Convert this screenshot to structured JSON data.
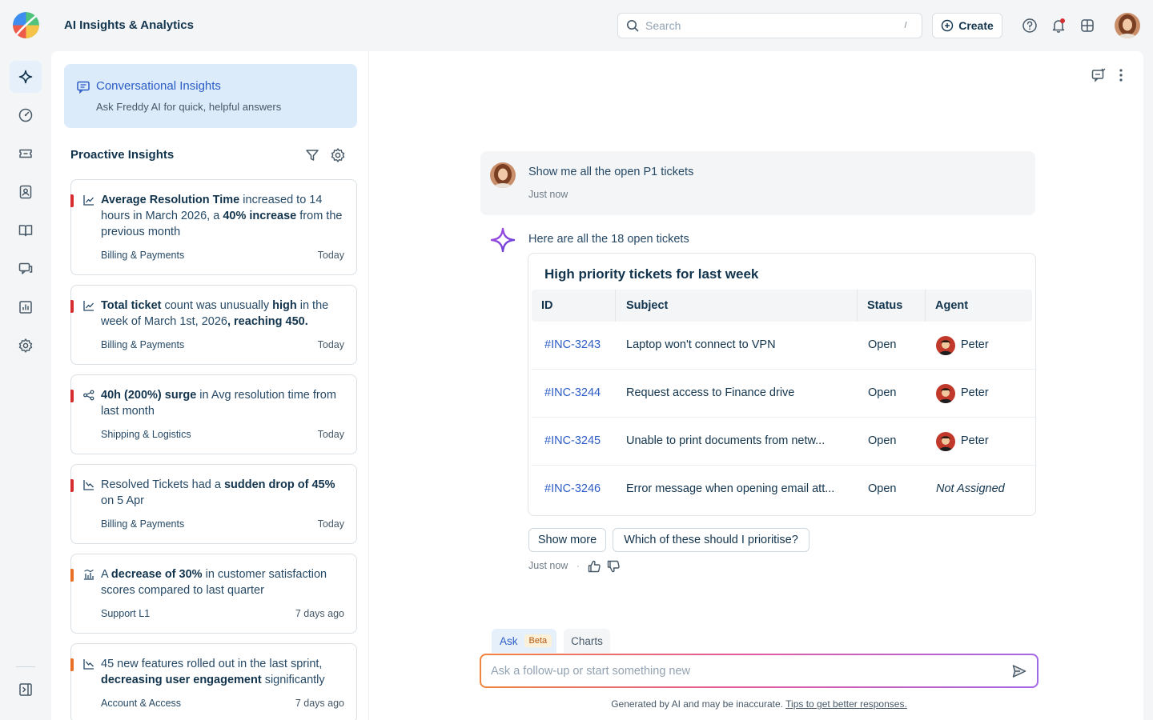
{
  "app": {
    "title": "AI Insights & Analytics"
  },
  "search": {
    "placeholder": "Search",
    "shortcut": "/"
  },
  "create": {
    "label": "Create"
  },
  "nav": {
    "icons": [
      "sparkle-icon",
      "dashboard-icon",
      "ticket-icon",
      "contacts-icon",
      "knowledge-base-icon",
      "chat-icon",
      "reports-icon",
      "settings-icon"
    ],
    "collapse_icon": "sidebar-collapse-icon"
  },
  "conversational": {
    "title": "Conversational Insights",
    "subtitle": "Ask Freddy AI for quick, helpful answers"
  },
  "proactive": {
    "title": "Proactive Insights",
    "insights": [
      {
        "parts": [
          {
            "t": "Average Resolution Time",
            "b": true
          },
          {
            "t": " increased to 14 hours in March 2026, a ",
            "b": false
          },
          {
            "t": "40% increase",
            "b": true
          },
          {
            "t": " from the previous month",
            "b": false
          }
        ],
        "category": "Billing & Payments",
        "when": "Today",
        "severity": "high",
        "icon": "trend-up-icon"
      },
      {
        "parts": [
          {
            "t": "Total ticket",
            "b": true
          },
          {
            "t": " count was unusually ",
            "b": false
          },
          {
            "t": "high",
            "b": true
          },
          {
            "t": " in the week of March 1st, 2026",
            "b": false
          },
          {
            "t": ", reaching 450.",
            "b": true
          }
        ],
        "category": "Billing & Payments",
        "when": "Today",
        "severity": "high",
        "icon": "trend-up-icon"
      },
      {
        "parts": [
          {
            "t": "40h (200%) surge",
            "b": true
          },
          {
            "t": " in Avg resolution time from last month",
            "b": false
          }
        ],
        "category": "Shipping & Logistics",
        "when": "Today",
        "severity": "high",
        "icon": "anomaly-icon"
      },
      {
        "parts": [
          {
            "t": "Resolved Tickets had a ",
            "b": false
          },
          {
            "t": "sudden drop of 45%",
            "b": true
          },
          {
            "t": " on 5 Apr",
            "b": false
          }
        ],
        "category": "Billing & Payments",
        "when": "Today",
        "severity": "high",
        "icon": "trend-down-icon"
      },
      {
        "parts": [
          {
            "t": "A ",
            "b": false
          },
          {
            "t": "decrease of 30%",
            "b": true
          },
          {
            "t": " in customer satisfaction scores compared to last quarter",
            "b": false
          }
        ],
        "category": "Support L1",
        "when": "7 days ago",
        "severity": "medium",
        "icon": "bar-compare-icon"
      },
      {
        "parts": [
          {
            "t": "45 new features rolled out in the last sprint, ",
            "b": false
          },
          {
            "t": "decreasing user engagement",
            "b": true
          },
          {
            "t": " significantly",
            "b": false
          }
        ],
        "category": "Account & Access",
        "when": "7 days ago",
        "severity": "medium",
        "icon": "trend-down-icon"
      }
    ]
  },
  "chat": {
    "user_message": "Show me all the open P1 tickets",
    "user_time": "Just now",
    "ai_intro": "Here are all the 18 open tickets",
    "table": {
      "title": "High priority tickets for last week",
      "columns": [
        "ID",
        "Subject",
        "Status",
        "Agent"
      ],
      "rows": [
        {
          "id": "#INC-3243",
          "subject": "Laptop won't connect to VPN",
          "status": "Open",
          "agent": "Peter",
          "assigned": true
        },
        {
          "id": "#INC-3244",
          "subject": "Request access to Finance drive",
          "status": "Open",
          "agent": "Peter",
          "assigned": true
        },
        {
          "id": "#INC-3245",
          "subject": "Unable to print documents from netw...",
          "status": "Open",
          "agent": "Peter",
          "assigned": true
        },
        {
          "id": "#INC-3246",
          "subject": "Error message when opening email att...",
          "status": "Open",
          "agent": "Not Assigned",
          "assigned": false
        }
      ]
    },
    "suggestions": [
      "Show more",
      "Which of these should I prioritise?"
    ],
    "ai_time": "Just now",
    "ai_dot": "·"
  },
  "composer": {
    "tabs": {
      "ask": "Ask",
      "beta": "Beta",
      "charts": "Charts"
    },
    "placeholder": "Ask a follow-up or start something new",
    "disclaimer": "Generated by AI and may be inaccurate.",
    "tips_link": "Tips to get better responses."
  },
  "colors": {
    "accent": "#2c5cc5",
    "high": "#d72d30",
    "medium": "#e86f25",
    "active_nav": "#e5f0fb"
  }
}
